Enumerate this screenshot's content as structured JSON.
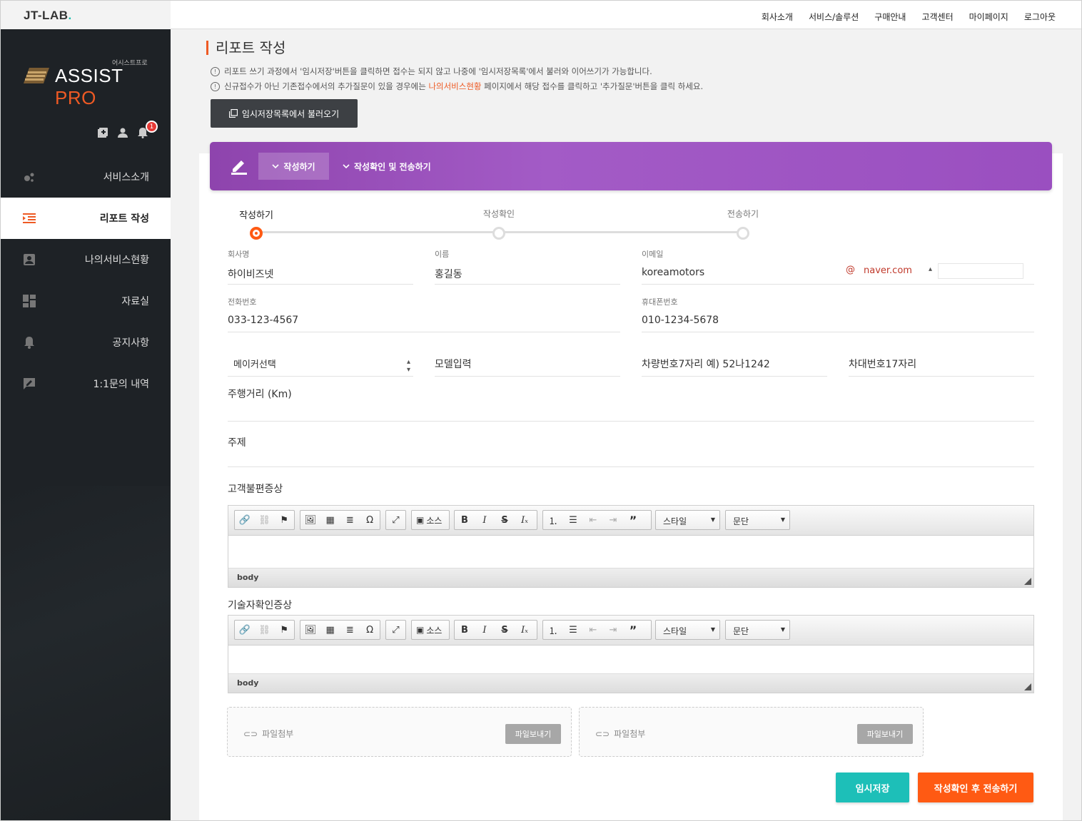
{
  "brand": {
    "name": "JT-LAB",
    "dot": "."
  },
  "topnav": [
    "회사소개",
    "서비스/솔루션",
    "구매안내",
    "고객센터",
    "마이페이지",
    "로그아웃"
  ],
  "logo": {
    "small": "어시스트프로",
    "main": "ASSIST",
    "accent": "PRO"
  },
  "notifications": {
    "count": "1"
  },
  "sidebar": {
    "items": [
      {
        "label": "서비스소개",
        "icon": "dots-icon"
      },
      {
        "label": "리포트 작성",
        "icon": "list-indent-icon",
        "active": true
      },
      {
        "label": "나의서비스현황",
        "icon": "account-box-icon"
      },
      {
        "label": "자료실",
        "icon": "dashboard-icon"
      },
      {
        "label": "공지사항",
        "icon": "bell-icon"
      },
      {
        "label": "1:1문의 내역",
        "icon": "chat-edit-icon"
      }
    ]
  },
  "page": {
    "title": "리포트 작성",
    "note1": "리포트 쓰기 과정에서 '임시저장'버튼을 클릭하면 접수는 되지 않고 나중에 '임시저장목록'에서 불러와 이어쓰기가 가능합니다.",
    "note2_pre": "신규접수가 아닌 기존접수에서의 추가질문이 있을 경우에는 ",
    "note2_hl": "나의서비스현황",
    "note2_post": " 페이지에서 해당 접수를 클릭하고 '추가질문'버튼을 클릭 하세요.",
    "load_button": "임시저장목록에서 불러오기"
  },
  "tabs": {
    "write": "작성하기",
    "confirm_send": "작성확인 및 전송하기"
  },
  "steps": [
    "작성하기",
    "작성확인",
    "전송하기"
  ],
  "form": {
    "company_label": "회사명",
    "company_value": "하이비즈넷",
    "name_label": "이름",
    "name_value": "홍길동",
    "email_label": "이메일",
    "email_user": "koreamotors",
    "email_at": "@",
    "email_domain": "naver.com",
    "phone_label": "전화번호",
    "phone_value": "033-123-4567",
    "mobile_label": "휴대폰번호",
    "mobile_value": "010-1234-5678",
    "maker_placeholder": "메이커선택",
    "model_placeholder": "모델입력",
    "carno_placeholder": "차량번호7자리 예) 52나1242",
    "vin_placeholder": "차대번호17자리",
    "mileage_label": "주행거리 (Km)",
    "subject_label": "주제",
    "symptom_label": "고객불편증상",
    "tech_label": "기술자확인증상"
  },
  "editor": {
    "source": "소스",
    "style": "스타일",
    "format": "문단",
    "path": "body"
  },
  "files": {
    "label": "파일첨부",
    "button": "파일보내기"
  },
  "buttons": {
    "save": "임시저장",
    "submit": "작성확인 후 전송하기"
  },
  "colors": {
    "accent": "#ee5a24",
    "purple": "#9b4fc0",
    "teal": "#1dbfb8",
    "orange": "#ff5a13"
  }
}
